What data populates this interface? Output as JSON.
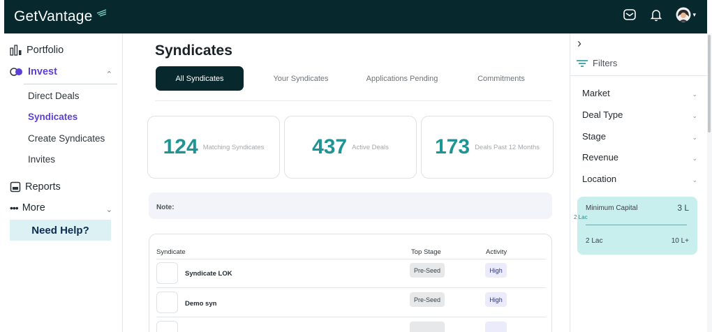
{
  "header": {
    "brand": "GetVantage",
    "icons": [
      "mail-icon",
      "bell-icon",
      "avatar"
    ]
  },
  "sidebar": {
    "portfolio": "Portfolio",
    "invest": "Invest",
    "invest_items": [
      "Direct Deals",
      "Syndicates",
      "Create Syndicates",
      "Invites"
    ],
    "active_item": "Syndicates",
    "reports": "Reports",
    "more": "More",
    "help": "Need Help?"
  },
  "main": {
    "title": "Syndicates",
    "tabs": [
      "All Syndicates",
      "Your Syndicates",
      "Applications Pending",
      "Commitments"
    ],
    "active_tab": "All Syndicates",
    "stats": [
      {
        "value": "124",
        "caption": "Matching Syndicates"
      },
      {
        "value": "437",
        "caption": "Active Deals"
      },
      {
        "value": "173",
        "caption": "Deals Past 12 Months"
      }
    ],
    "note_label": "Note:",
    "table": {
      "headers": [
        "Syndicate",
        "Top Stage",
        "Activity"
      ],
      "rows": [
        {
          "name": "Syndicate LOK",
          "stage": "Pre-Seed",
          "activity": "High"
        },
        {
          "name": "Demo syn",
          "stage": "Pre-Seed",
          "activity": "High"
        }
      ]
    }
  },
  "filters": {
    "title": "Filters",
    "items": [
      "Market",
      "Deal Type",
      "Stage",
      "Revenue",
      "Location"
    ],
    "capital": {
      "title": "Minimum Capital",
      "value": "3 L",
      "marker": "2 Lac",
      "min": "2 Lac",
      "max": "10 L+"
    }
  },
  "colors": {
    "header_bg": "#07292e",
    "accent_teal": "#1e9494",
    "active_link": "#5b3fd6",
    "help_bg": "#dcf1f3",
    "capital_bg": "#c9eeee"
  }
}
